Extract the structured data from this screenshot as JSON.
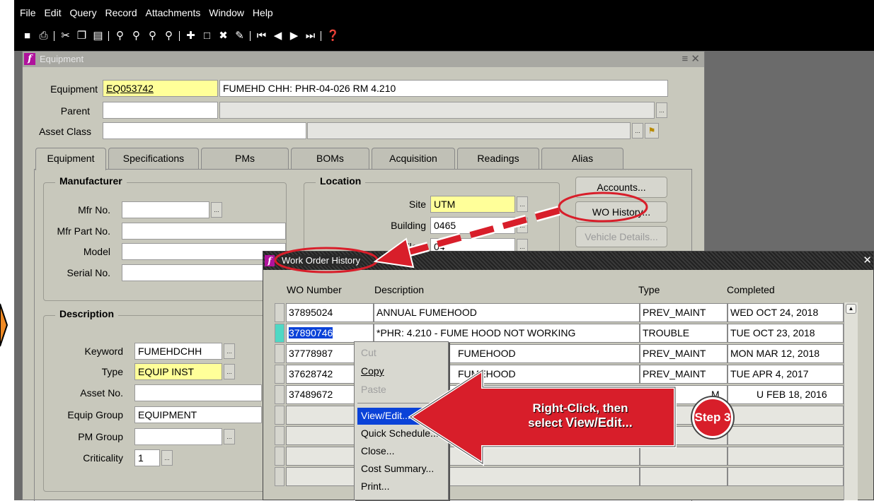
{
  "menu": [
    "File",
    "Edit",
    "Query",
    "Record",
    "Attachments",
    "Window",
    "Help"
  ],
  "toolbar_icons": [
    "save-icon",
    "print-icon",
    "cut-icon",
    "copy-icon",
    "paste-icon",
    "find-icon",
    "find-all-icon",
    "zoom-icon",
    "translate-icon",
    "new-record-icon",
    "clear-record-icon",
    "delete-record-icon",
    "edit-field-icon",
    "first-record-icon",
    "previous-record-icon",
    "next-record-icon",
    "last-record-icon",
    "help-icon"
  ],
  "equipment_window": {
    "title": "Equipment",
    "fields": {
      "equipment_label": "Equipment",
      "equipment_value": "EQ053742",
      "equipment_desc": "FUMEHD CHH: PHR-04-026 RM 4.210",
      "parent_label": "Parent",
      "asset_class_label": "Asset Class"
    },
    "tabs": [
      "Equipment",
      "Specifications",
      "PMs",
      "BOMs",
      "Acquisition",
      "Readings",
      "Alias"
    ],
    "manufacturer": {
      "title": "Manufacturer",
      "mfr_no_label": "Mfr No.",
      "mfr_part_label": "Mfr Part No.",
      "model_label": "Model",
      "serial_label": "Serial No."
    },
    "location": {
      "title": "Location",
      "site_label": "Site",
      "site_value": "UTM",
      "building_label": "Building",
      "building_value": "0465",
      "floor_label": "Floor",
      "floor_value": "04"
    },
    "buttons": {
      "accounts": "Accounts...",
      "wo_history": "WO History...",
      "vehicle_details": "Vehicle Details..."
    },
    "description": {
      "title": "Description",
      "keyword_label": "Keyword",
      "keyword_value": "FUMEHDCHH",
      "type_label": "Type",
      "type_value": "EQUIP INST",
      "asset_no_label": "Asset No.",
      "equip_group_label": "Equip Group",
      "equip_group_value": "EQUIPMENT",
      "pm_group_label": "PM Group",
      "criticality_label": "Criticality",
      "criticality_value": "1"
    }
  },
  "wo_history": {
    "title": "Work Order History",
    "columns": [
      "WO Number",
      "Description",
      "Type",
      "Completed"
    ],
    "rows": [
      {
        "wo": "37895024",
        "desc": "ANNUAL FUMEHOOD",
        "type": "PREV_MAINT",
        "completed": "WED OCT 24, 2018"
      },
      {
        "wo": "37890746",
        "desc": "*PHR: 4.210 - FUME HOOD NOT WORKING",
        "type": "TROUBLE",
        "completed": "TUE OCT 23, 2018"
      },
      {
        "wo": "37778987",
        "desc": "FUMEHOOD",
        "type": "PREV_MAINT",
        "completed": "MON MAR 12, 2018"
      },
      {
        "wo": "37628742",
        "desc": "FUMEHOOD",
        "type": "PREV_MAINT",
        "completed": "TUE APR 4, 2017"
      },
      {
        "wo": "37489672",
        "desc": "FUME",
        "type": "M",
        "completed": "U FEB 18, 2016"
      }
    ]
  },
  "context_menu": {
    "items": [
      "Cut",
      "Copy",
      "Paste",
      "View/Edit...",
      "Quick Schedule...",
      "Close...",
      "Cost Summary...",
      "Print..."
    ],
    "highlighted": "View/Edit..."
  },
  "annotation": {
    "callout_line1": "Right-Click, then",
    "callout_line2_prefix": "select",
    "callout_line2_bold": "View/Edit...",
    "step": "Step 3",
    "color": "#d81e2a"
  }
}
